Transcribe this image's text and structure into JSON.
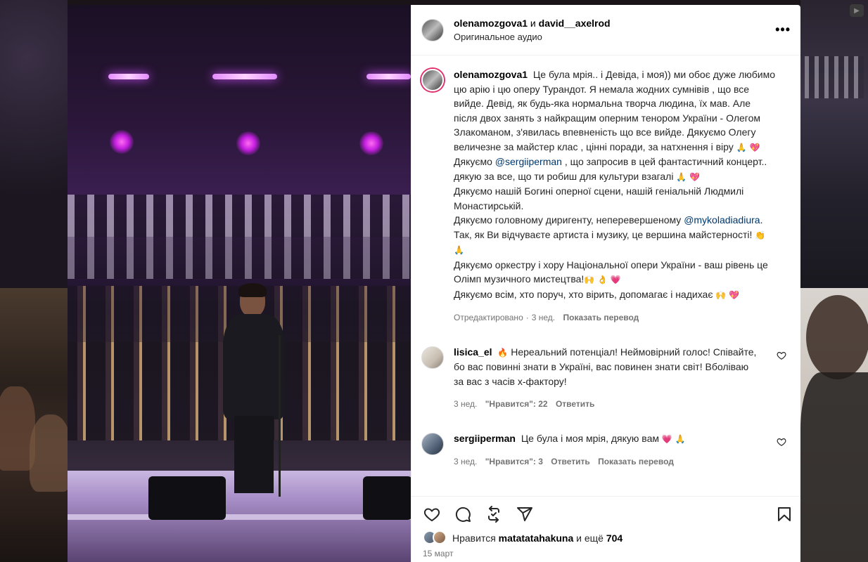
{
  "post": {
    "author1": "olenamozgova1",
    "and_word": "и",
    "author2": "david__axelrod",
    "audio": "Оригинальное аудио",
    "more_label": "•••"
  },
  "caption": {
    "username": "olenamozgova1",
    "p1": "Це була мрія.. і Девіда, і моя)) ми обоє дуже любимо цю арію і цю оперу Турандот. Я немала жодних сумнівів , що все вийде. Девід, як будь-яка нормальна творча людина, їх мав. Але після двох занять з найкращим оперним тенором України - Олегом Злакоманом, з'явилась впевненість що все вийде. Дякуємо Олегу величезне за майстер клас , цінні поради, за натхнення і віру",
    "p1_emoji": "🙏 💖",
    "p2_before": "Дякуємо ",
    "p2_mention": "@sergiiperman",
    "p2_after": " , що запросив в цей фантастичний концерт.. дякую за все, що ти робиш для культури взагалі",
    "p2_emoji": "🙏 💖",
    "p3": "Дякуємо нашій Богині оперної сцени, нашій геніальній Людмилі Монастирській.",
    "p4_before": "Дякуємо головному диригенту, неперевершеному ",
    "p4_mention": "@mykoladiadiura",
    "p4_after": ". Так, як Ви відчуваєте артиста і музику, це вершина майстерності!",
    "p4_emoji": "👏 🙏",
    "p5": "Дякуємо оркестру і хору Національної опери України - ваш рівень це Олімп музичного мистецтва!",
    "p5_emoji": "🙌 👌 💗",
    "p6": "Дякуємо всім, хто поруч, хто вірить, допомагає і надихає",
    "p6_emoji": "🙌 💖",
    "edited": "Отредактировано",
    "time": "3 нед.",
    "translate": "Показать перевод"
  },
  "comments": [
    {
      "username": "lisica_el",
      "text": "Нереальний потенціал! Неймовірний голос! Співайте, бо вас повинні знати в Україні, вас повинен знати світ! Вболіваю за вас з часів х-фактору!",
      "emoji": "🔥",
      "time": "3 нед.",
      "likes": "\"Нравится\": 22",
      "reply": "Ответить",
      "translate": ""
    },
    {
      "username": "sergiiperman",
      "text": "Це була і моя мрія, дякую вам",
      "emoji": "💗 🙏",
      "time": "3 нед.",
      "likes": "\"Нравится\": 3",
      "reply": "Ответить",
      "translate": "Показать перевод"
    }
  ],
  "likes": {
    "prefix": "Нравится",
    "user": "matatatahakuna",
    "suffix": "и ещё",
    "count": "704"
  },
  "date": "15 март",
  "icons": [
    "heart-icon",
    "comment-icon",
    "repost-icon",
    "share-icon",
    "bookmark-icon",
    "more-icon"
  ]
}
